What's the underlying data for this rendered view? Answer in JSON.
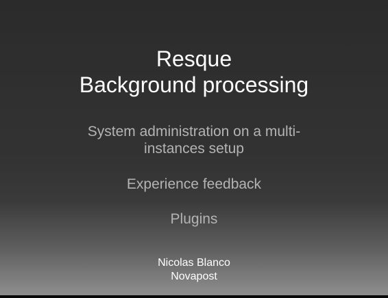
{
  "slide": {
    "title_line1": "Resque",
    "title_line2": "Background processing",
    "bullets": {
      "item1_line1": "System administration on a multi-",
      "item1_line2": "instances setup",
      "item2": "Experience feedback",
      "item3": "Plugins"
    },
    "author": {
      "name": "Nicolas Blanco",
      "organization": "Novapost"
    }
  },
  "colors": {
    "title": "#ffffff",
    "bullet_text": "#b4b4b4",
    "background_top": "#2b2b2b",
    "background_bottom": "#8e8e8e"
  }
}
